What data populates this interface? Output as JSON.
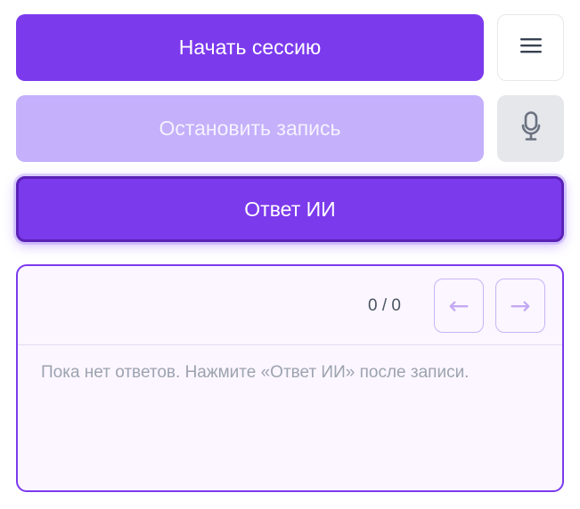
{
  "controls": {
    "start_session_label": "Начать сессию",
    "stop_recording_label": "Остановить запись",
    "ai_answer_label": "Ответ ИИ"
  },
  "side_buttons": {
    "menu_icon": "menu-icon",
    "mic_icon": "microphone-icon"
  },
  "answers": {
    "counter": "0 / 0",
    "prev_glyph": "←",
    "next_glyph": "→",
    "empty_text": "Пока нет ответов. Нажмите «Ответ ИИ» после записи."
  },
  "colors": {
    "accent": "#7c3aed",
    "accent_disabled": "#c4b0fb",
    "panel_bg": "#fbf6ff",
    "muted_text": "#9ca3af"
  }
}
